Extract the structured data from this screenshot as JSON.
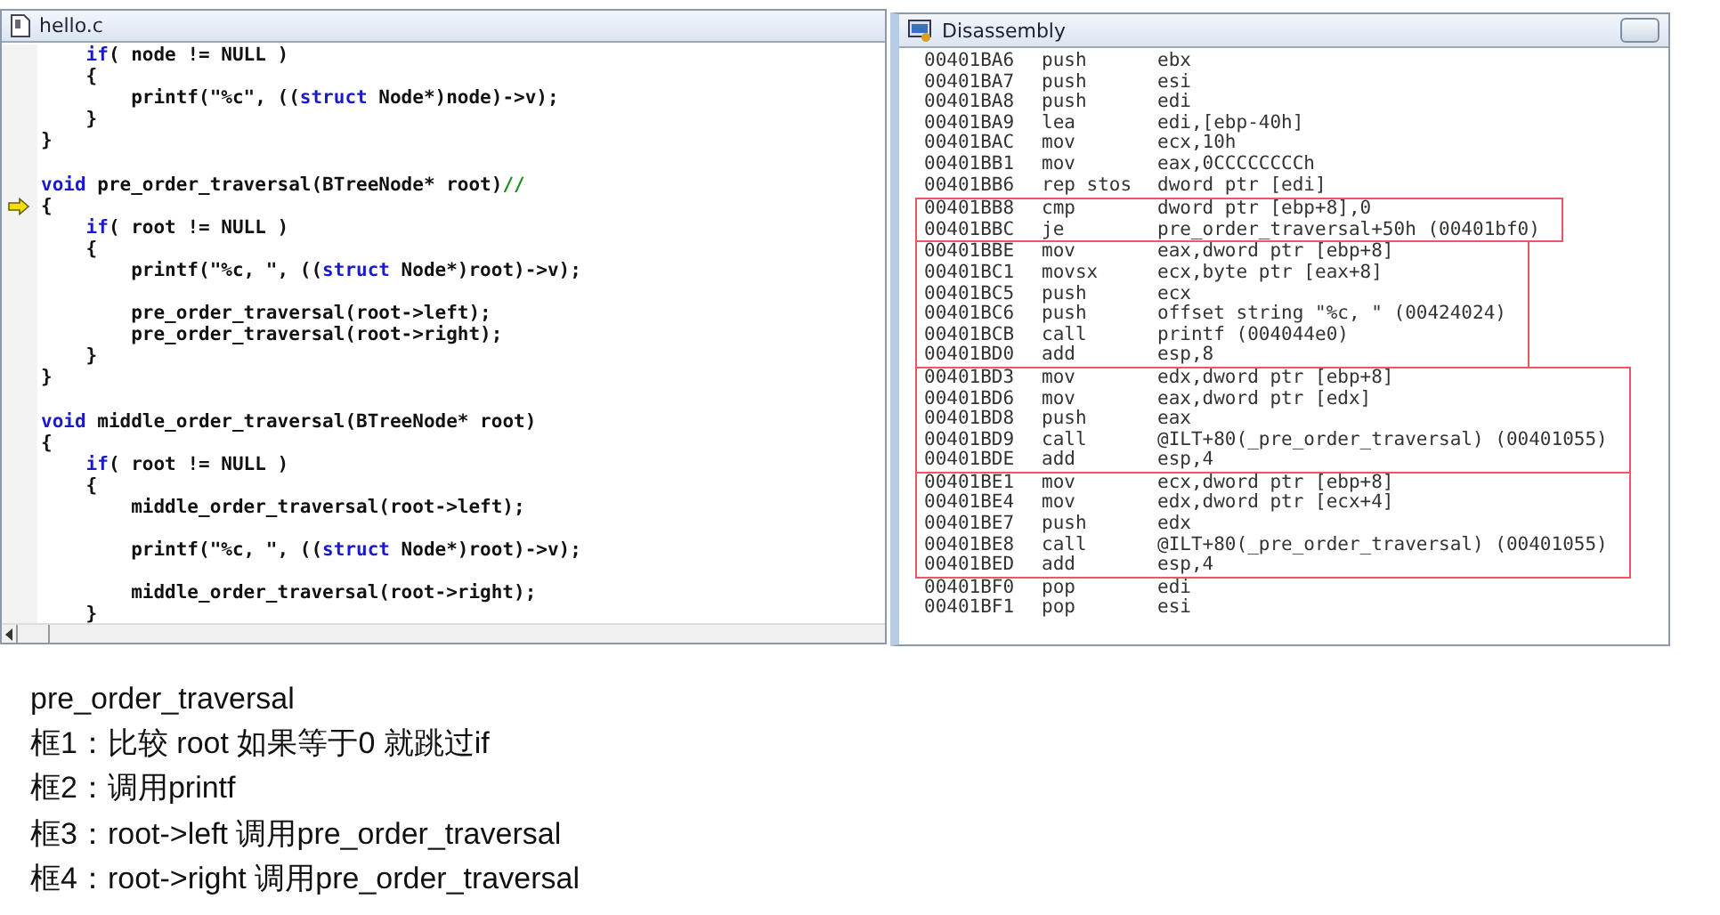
{
  "editor": {
    "title": "hello.c",
    "lines": [
      {
        "parts": [
          {
            "text": "    if",
            "kind": "keyword"
          },
          {
            "text": "( node != NULL )"
          }
        ]
      },
      {
        "parts": [
          {
            "text": "    {"
          }
        ]
      },
      {
        "parts": [
          {
            "text": "        printf(\"%c\", (("
          },
          {
            "text": "struct",
            "kind": "keyword"
          },
          {
            "text": " Node*)node)->v);"
          }
        ]
      },
      {
        "parts": [
          {
            "text": "    }"
          }
        ]
      },
      {
        "parts": [
          {
            "text": "}"
          }
        ]
      },
      {
        "space_before": true,
        "parts": [
          {
            "text": "void",
            "kind": "keyword"
          },
          {
            "text": " pre_order_traversal(BTreeNode* root)"
          },
          {
            "text": "//",
            "kind": "comment"
          }
        ]
      },
      {
        "current": true,
        "parts": [
          {
            "text": "{"
          }
        ]
      },
      {
        "parts": [
          {
            "text": "    if",
            "kind": "keyword"
          },
          {
            "text": "( root != NULL )"
          }
        ]
      },
      {
        "parts": [
          {
            "text": "    {"
          }
        ]
      },
      {
        "parts": [
          {
            "text": "        printf(\"%c, \", (("
          },
          {
            "text": "struct",
            "kind": "keyword"
          },
          {
            "text": " Node*)root)->v);"
          }
        ]
      },
      {
        "space_before": true,
        "parts": [
          {
            "text": "        pre_order_traversal(root->left);"
          }
        ]
      },
      {
        "parts": [
          {
            "text": "        pre_order_traversal(root->right);"
          }
        ]
      },
      {
        "parts": [
          {
            "text": "    }"
          }
        ]
      },
      {
        "parts": [
          {
            "text": "}"
          }
        ]
      },
      {
        "space_before": true,
        "parts": [
          {
            "text": "void",
            "kind": "keyword"
          },
          {
            "text": " middle_order_traversal(BTreeNode* root)"
          }
        ]
      },
      {
        "parts": [
          {
            "text": "{"
          }
        ]
      },
      {
        "parts": [
          {
            "text": "    if",
            "kind": "keyword"
          },
          {
            "text": "( root != NULL )"
          }
        ]
      },
      {
        "parts": [
          {
            "text": "    {"
          }
        ]
      },
      {
        "parts": [
          {
            "text": "        middle_order_traversal(root->left);"
          }
        ]
      },
      {
        "space_before": true,
        "parts": [
          {
            "text": "        printf(\"%c, \", (("
          },
          {
            "text": "struct",
            "kind": "keyword"
          },
          {
            "text": " Node*)root)->v);"
          }
        ]
      },
      {
        "space_before": true,
        "parts": [
          {
            "text": "        middle_order_traversal(root->right);"
          }
        ]
      },
      {
        "parts": [
          {
            "text": "    }"
          }
        ]
      }
    ]
  },
  "disassembly": {
    "title": "Disassembly",
    "sections": [
      {
        "boxed": false,
        "rows": [
          [
            "00401BA6",
            "push",
            "ebx"
          ],
          [
            "00401BA7",
            "push",
            "esi"
          ],
          [
            "00401BA8",
            "push",
            "edi"
          ],
          [
            "00401BA9",
            "lea",
            "edi,[ebp-40h]"
          ],
          [
            "00401BAC",
            "mov",
            "ecx,10h"
          ],
          [
            "00401BB1",
            "mov",
            "eax,0CCCCCCCCh"
          ],
          [
            "00401BB6",
            "rep stos",
            "dword ptr [edi]"
          ]
        ]
      },
      {
        "boxed": true,
        "rows": [
          [
            "00401BB8",
            "cmp",
            "dword ptr [ebp+8],0"
          ],
          [
            "00401BBC",
            "je",
            "pre_order_traversal+50h (00401bf0)"
          ]
        ]
      },
      {
        "boxed": true,
        "rows": [
          [
            "00401BBE",
            "mov",
            "eax,dword ptr [ebp+8]"
          ],
          [
            "00401BC1",
            "movsx",
            "ecx,byte ptr [eax+8]"
          ],
          [
            "00401BC5",
            "push",
            "ecx"
          ],
          [
            "00401BC6",
            "push",
            "offset string \"%c, \" (00424024)"
          ],
          [
            "00401BCB",
            "call",
            "printf (004044e0)"
          ],
          [
            "00401BD0",
            "add",
            "esp,8"
          ]
        ]
      },
      {
        "boxed": true,
        "rows": [
          [
            "00401BD3",
            "mov",
            "edx,dword ptr [ebp+8]"
          ],
          [
            "00401BD6",
            "mov",
            "eax,dword ptr [edx]"
          ],
          [
            "00401BD8",
            "push",
            "eax"
          ],
          [
            "00401BD9",
            "call",
            "@ILT+80(_pre_order_traversal) (00401055)"
          ],
          [
            "00401BDE",
            "add",
            "esp,4"
          ]
        ]
      },
      {
        "boxed": true,
        "rows": [
          [
            "00401BE1",
            "mov",
            "ecx,dword ptr [ebp+8]"
          ],
          [
            "00401BE4",
            "mov",
            "edx,dword ptr [ecx+4]"
          ],
          [
            "00401BE7",
            "push",
            "edx"
          ],
          [
            "00401BE8",
            "call",
            "@ILT+80(_pre_order_traversal) (00401055)"
          ],
          [
            "00401BED",
            "add",
            "esp,4"
          ]
        ]
      },
      {
        "boxed": false,
        "rows": [
          [
            "00401BF0",
            "pop",
            "edi"
          ],
          [
            "00401BF1",
            "pop",
            "esi"
          ]
        ]
      }
    ]
  },
  "notes": [
    "pre_order_traversal",
    "框1：比较 root 如果等于0 就跳过if",
    "框2：调用printf",
    "框3：root->left 调用pre_order_traversal",
    "框4：root->right 调用pre_order_traversal"
  ]
}
